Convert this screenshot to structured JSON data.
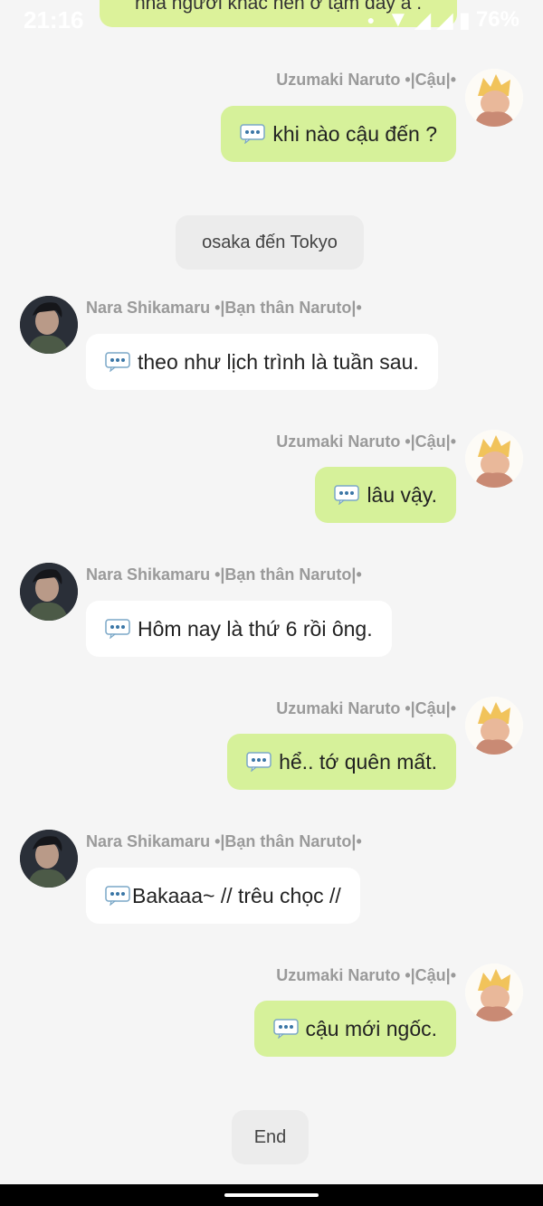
{
  "status_bar": {
    "time": "21:16",
    "battery": "76%"
  },
  "partial_message": "nhà người khác nên ở tạm đây à .",
  "naruto_name": "Uzumaki Naruto •|Cậu|•",
  "shikamaru_name": "Nara Shikamaru •|Bạn thân Naruto|•",
  "messages": [
    {
      "text": "khi nào cậu đến ?"
    },
    {
      "text": "osaka đến Tokyo"
    },
    {
      "text": "theo như lịch trình là tuần sau."
    },
    {
      "text": "lâu vậy."
    },
    {
      "text": "Hôm nay là thứ 6 rồi ông."
    },
    {
      "text": "hể.. tớ quên mất."
    },
    {
      "text": "Bakaaa~ // trêu chọc //"
    },
    {
      "text": "cậu mới ngốc."
    },
    {
      "text": "End"
    }
  ],
  "icons": {
    "speech": "speech-balloon-icon"
  },
  "colors": {
    "outgoing_bubble": "#d6f19a",
    "incoming_bubble": "#ffffff",
    "system_bubble": "#ececec",
    "background": "#f5f5f5"
  }
}
